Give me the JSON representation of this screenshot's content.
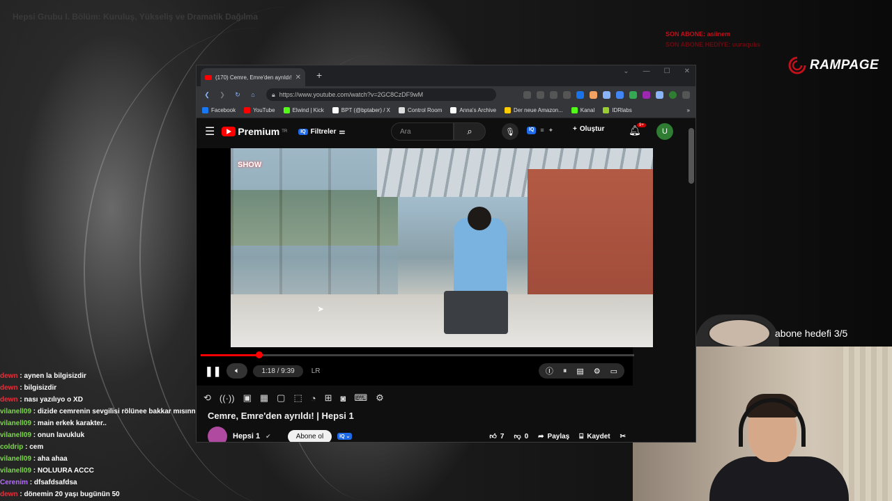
{
  "stream": {
    "title": "Hepsi Grubu I. Bölüm: Kuruluş, Yükseliş ve Dramatik Dağılma",
    "last_sub_label": "SON ABONE: asiinem",
    "last_sub_gift_label": "SON ABONE HEDİYE: uuraqulıs",
    "brand": "RAMPAGE",
    "sub_goal": "abone hedefi 3/5",
    "brand_color": "#c0101a"
  },
  "chat": [
    {
      "user": "dewn",
      "text": "aynen la bilgisizdir",
      "color": "#e0323c"
    },
    {
      "user": "dewn",
      "text": "bilgisizdir",
      "color": "#e0323c"
    },
    {
      "user": "dewn",
      "text": "nası yazılıyo o XD",
      "color": "#e0323c"
    },
    {
      "user": "vilanell09",
      "text": "dizide cemrenin sevgilisi rölünee bakkar mısınnn",
      "color": "#7bd84a"
    },
    {
      "user": "vilanell09",
      "text": "main erkek karakter..",
      "color": "#7bd84a"
    },
    {
      "user": "vilanell09",
      "text": "onun lavukluk",
      "color": "#7bd84a"
    },
    {
      "user": "coldrip",
      "text": "cem",
      "color": "#7bd84a"
    },
    {
      "user": "vilanell09",
      "text": "aha ahaa",
      "color": "#7bd84a"
    },
    {
      "user": "vilanell09",
      "text": "NOLUURA ACCC",
      "color": "#7bd84a"
    },
    {
      "user": "Cerenim",
      "text": "dfsafdsafdsa",
      "color": "#b46cff"
    },
    {
      "user": "dewn",
      "text": "dönemin 20 yaşı bugünün 50",
      "color": "#e0323c"
    }
  ],
  "browser": {
    "tab_title": "(170) Cemre, Emre'den ayrıldı!",
    "url": "https://www.youtube.com/watch?v=2GC8CzDF9wM",
    "bookmarks": [
      {
        "label": "Facebook",
        "color": "#1877f2"
      },
      {
        "label": "YouTube",
        "color": "#ff0000"
      },
      {
        "label": "Elwind | Kick",
        "color": "#53fc18"
      },
      {
        "label": "BPT (@bptaber) / X",
        "color": "#ffffff"
      },
      {
        "label": "Control Room",
        "color": "#dddddd"
      },
      {
        "label": "Anna's Archive",
        "color": "#ffffff"
      },
      {
        "label": "Der neue Amazon...",
        "color": "#ffcc00"
      },
      {
        "label": "Kanal",
        "color": "#53fc18"
      },
      {
        "label": "IDRlabs",
        "color": "#9acd32"
      }
    ]
  },
  "youtube": {
    "logo_text": "Premium",
    "logo_region": "TR",
    "filters_label": "Filtreler",
    "iq_label": "IQ",
    "search_placeholder": "Ara",
    "create_label": "Oluştur",
    "notif_count": "9+",
    "avatar_letter": "U",
    "show_logo": "SHOW",
    "time_display": "1:18 / 9:39",
    "progress": 0.135,
    "lr_label": "LR",
    "video_title": "Cemre, Emre'den ayrıldı! | Hepsi 1",
    "channel_name": "Hepsi 1",
    "subscribe_label": "Abone ol",
    "likes": "7",
    "dislikes": "0",
    "share_label": "Paylaş",
    "save_label": "Kaydet"
  }
}
